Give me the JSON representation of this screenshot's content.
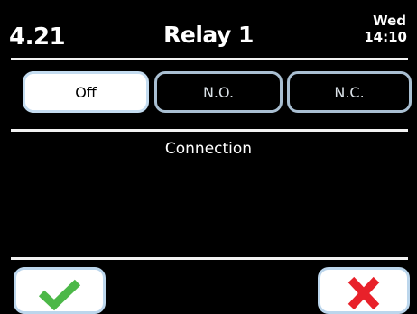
{
  "header": {
    "code": "4.21",
    "title": "Relay 1",
    "day": "Wed",
    "time": "14:10"
  },
  "options": [
    {
      "label": "Off",
      "selected": true
    },
    {
      "label": "N.O.",
      "selected": false
    },
    {
      "label": "N.C.",
      "selected": false
    }
  ],
  "section": {
    "label": "Connection"
  },
  "footer": {
    "confirm_icon": "checkmark-icon",
    "cancel_icon": "x-icon"
  },
  "colors": {
    "background": "#000000",
    "check": "#4cb848",
    "cross": "#e8212a",
    "button_border": "#a9bfd2"
  }
}
